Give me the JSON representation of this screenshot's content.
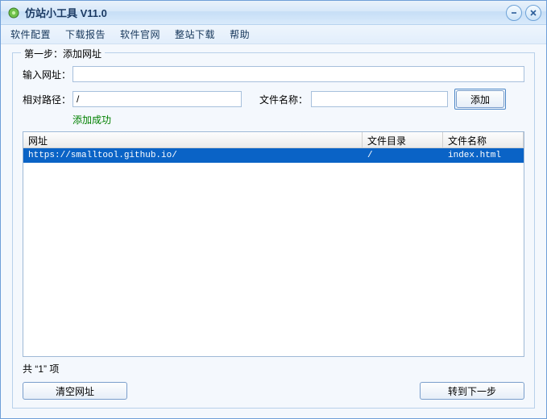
{
  "window": {
    "title": "仿站小工具 V11.0"
  },
  "menu": {
    "items": [
      "软件配置",
      "下载报告",
      "软件官网",
      "整站下载",
      "帮助"
    ]
  },
  "group": {
    "title": "第一步：添加网址",
    "labels": {
      "url": "输入网址：",
      "relpath": "相对路径：",
      "filename": "文件名称："
    },
    "values": {
      "url": "",
      "relpath": "/",
      "filename": ""
    },
    "add_button": "添加",
    "status": "添加成功",
    "columns": {
      "url": "网址",
      "dir": "文件目录",
      "file": "文件名称"
    },
    "rows": [
      {
        "url": "https://smalltool.github.io/",
        "dir": "/",
        "file": "index.html",
        "selected": true
      }
    ],
    "count_prefix": "共 “",
    "count": "1",
    "count_suffix": "” 项",
    "clear_button": "清空网址",
    "next_button": "转到下一步"
  }
}
